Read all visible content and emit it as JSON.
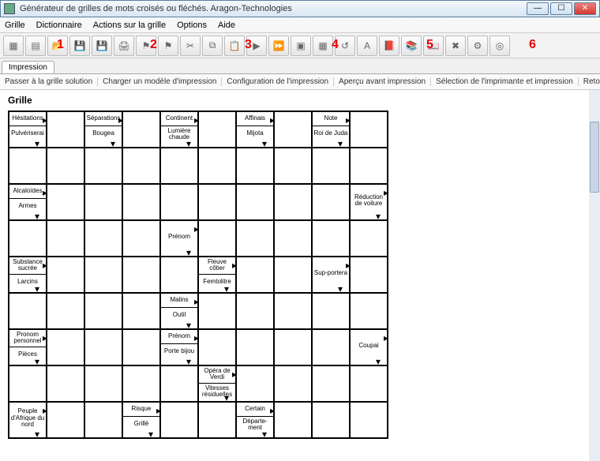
{
  "window": {
    "title": "Générateur de grilles de mots croisés ou fléchés. Aragon-Technologies"
  },
  "menu": {
    "items": [
      "Grille",
      "Dictionnaire",
      "Actions sur la grille",
      "Options",
      "Aide"
    ]
  },
  "red_numbers": [
    "1",
    "2",
    "3",
    "4",
    "5",
    "6"
  ],
  "tabs": {
    "active": "Impression"
  },
  "subtoolbar": {
    "items": [
      "Passer à la grille solution",
      "Charger un modèle d'impression",
      "Configuration de l'impression",
      "Aperçu avant impression",
      "Sélection de l'imprimante et impression",
      "Retour à la grille"
    ]
  },
  "content": {
    "title": "Grille"
  },
  "clues": {
    "r0c0": {
      "top": "Hésitations",
      "bot": "Pulvériserai"
    },
    "r0c2": {
      "top": "Séparations",
      "bot": "Bougea"
    },
    "r0c4": {
      "top": "Continent",
      "bot": "Lumière chaude"
    },
    "r0c6": {
      "top": "Affinais",
      "bot": "Mijota"
    },
    "r0c8": {
      "top": "Note",
      "bot": "Roi de Juda"
    },
    "r2c0": {
      "top": "Alcaloïdes",
      "bot": "Armes"
    },
    "r2c9": {
      "top": "Réduction de voilure",
      "bot": ""
    },
    "r3c4": {
      "top": "Prénom",
      "bot": ""
    },
    "r4c0": {
      "top": "Substance sucrée",
      "bot": "Larcins"
    },
    "r4c5": {
      "top": "Fleuve côtier",
      "bot": "Femtolitre"
    },
    "r4c8": {
      "top": "Sup-portera",
      "bot": ""
    },
    "r5c4": {
      "top": "Malins",
      "bot": "Outil"
    },
    "r6c0": {
      "top": "Pronom personnel",
      "bot": "Pièces"
    },
    "r6c4": {
      "top": "Prénom",
      "bot": "Porte bijou"
    },
    "r6c9": {
      "top": "Coupai",
      "bot": ""
    },
    "r7c5": {
      "top": "Opéra de Verdi",
      "bot": "Vitesses résiduelles"
    },
    "r8c0": {
      "top": "Peuple d'Afrique du nord",
      "bot": ""
    },
    "r8c3": {
      "top": "Risque",
      "bot": "Grillé"
    },
    "r8c6": {
      "top": "Certain",
      "bot": "Départe-ment"
    }
  },
  "toolbar_icons": [
    "new-grid-icon",
    "grid-icon",
    "open-icon",
    "save-icon",
    "saveas-icon",
    "print-icon",
    "flag1-icon",
    "flag2-icon",
    "cut-icon",
    "copy-icon",
    "paste-icon",
    "play-icon",
    "fast-icon",
    "box1-icon",
    "box2-icon",
    "undo-icon",
    "letter-icon",
    "book1-icon",
    "book2-icon",
    "book3-icon",
    "tool-icon",
    "gear-icon",
    "disc-icon"
  ]
}
